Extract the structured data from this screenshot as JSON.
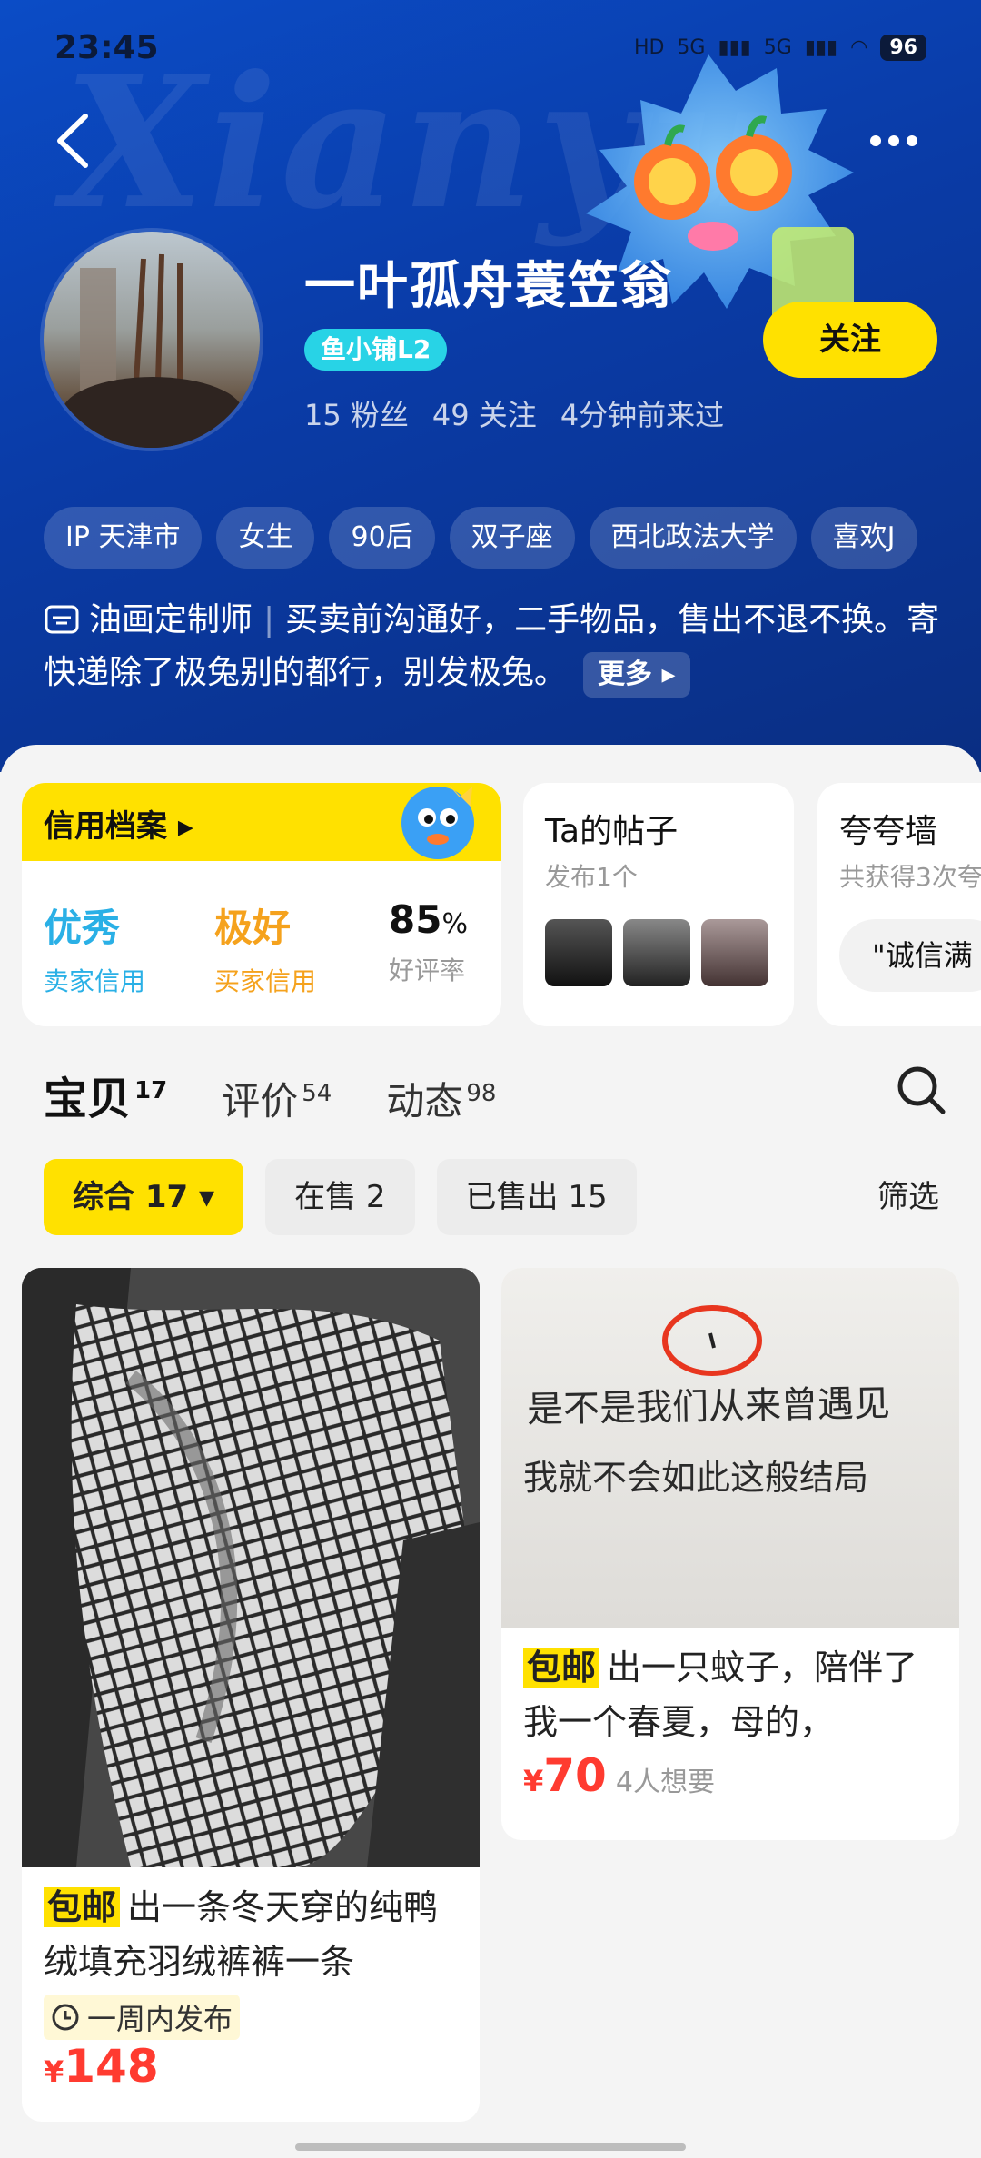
{
  "status_bar": {
    "time": "23:45",
    "network_labels": [
      "HD",
      "5G",
      "5G"
    ],
    "battery": "96"
  },
  "profile": {
    "nickname": "一叶孤舟蓑笠翁",
    "shop_badge": "鱼小铺L2",
    "stats": {
      "fans": "15 粉丝",
      "following": "49 关注",
      "last_seen": "4分钟前来过"
    },
    "follow_label": "关注",
    "tags": [
      "IP 天津市",
      "女生",
      "90后",
      "双子座",
      "西北政法大学",
      "喜欢J"
    ],
    "bio_role": "油画定制师",
    "bio_text": "买卖前沟通好，二手物品，售出不退不换。寄快递除了极兔别的都行，别发极兔。",
    "more_label": "更多"
  },
  "credit_card": {
    "title": "信用档案",
    "seller": {
      "value": "优秀",
      "label": "卖家信用",
      "color": "#2ab0e6"
    },
    "buyer": {
      "value": "极好",
      "label": "买家信用",
      "color": "#f5a21d"
    },
    "rating": {
      "value": "85",
      "unit": "%",
      "label": "好评率"
    }
  },
  "posts_card": {
    "title": "Ta的帖子",
    "subtitle": "发布1个"
  },
  "praise_card": {
    "title": "夸夸墙",
    "subtitle": "共获得3次夸",
    "pill": "\"诚信满"
  },
  "tabs": [
    {
      "label": "宝贝",
      "count": "17"
    },
    {
      "label": "评价",
      "count": "54"
    },
    {
      "label": "动态",
      "count": "98"
    }
  ],
  "filters": {
    "comprehensive": "综合 17",
    "on_sale": "在售 2",
    "sold": "已售出 15",
    "filter_label": "筛选"
  },
  "items": [
    {
      "free_shipping": "包邮",
      "title": "出一条冬天穿的纯鸭绒填充羽绒裤裤一条",
      "meta": "一周内发布",
      "price": "148",
      "currency": "¥"
    },
    {
      "free_shipping": "包邮",
      "title": "出一只蚊子，陪伴了我一个春夏，母的，",
      "price": "70",
      "currency": "¥",
      "wants": "4人想要",
      "image_text_line1": "是不是我们从来曾遇见",
      "image_text_line2": "我就不会如此这般结局"
    }
  ],
  "accent": {
    "yellow": "#ffe100",
    "blue": "#0a3ba6",
    "price_red": "#ff3b30"
  }
}
